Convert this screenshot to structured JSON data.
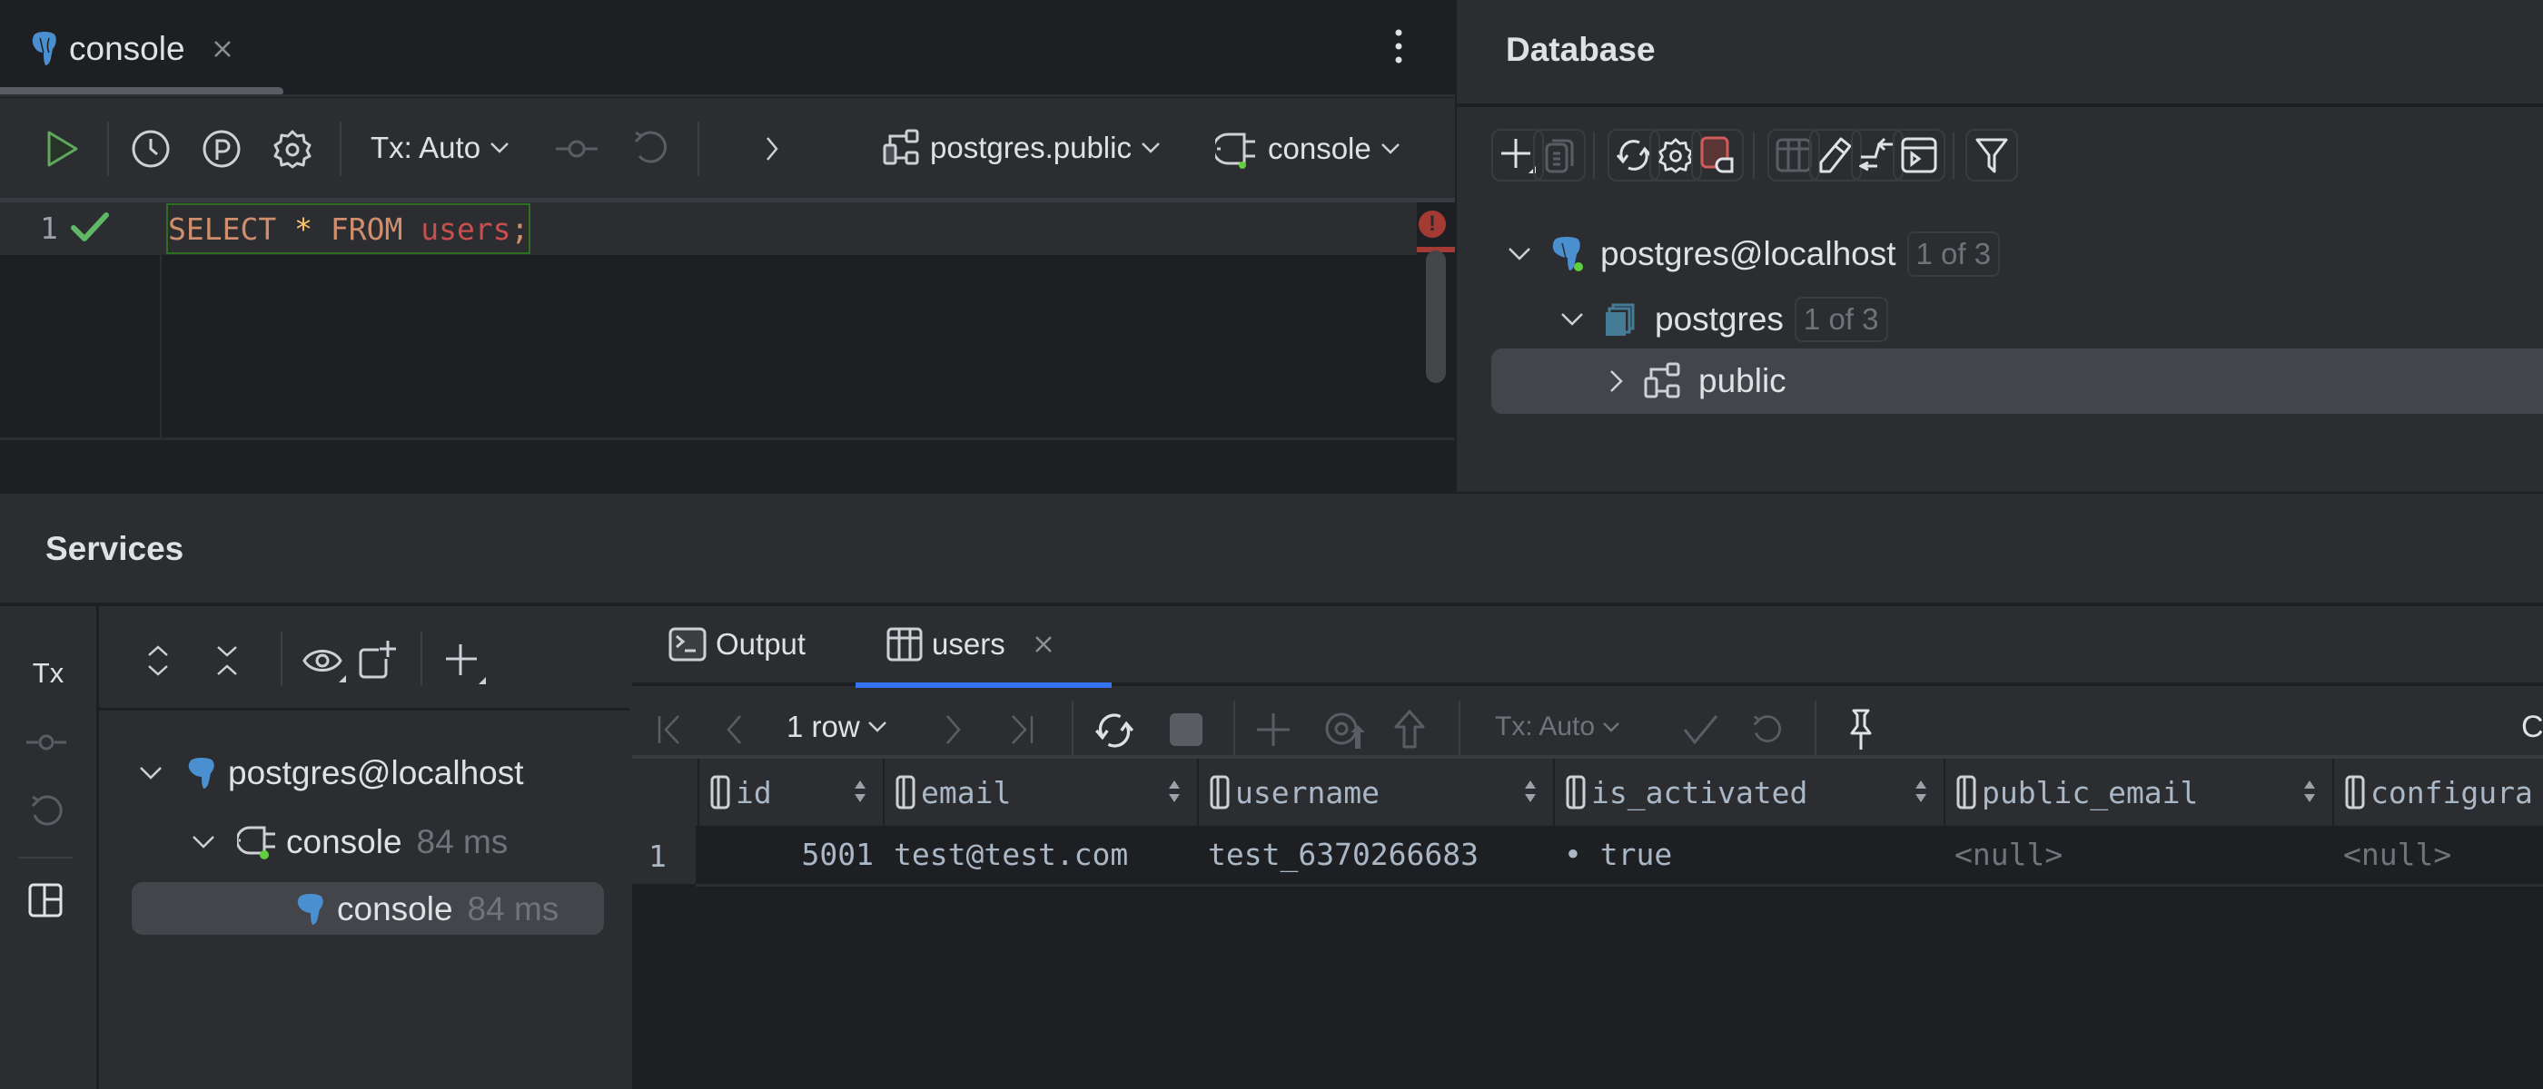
{
  "editor": {
    "tab": {
      "icon": "postgresql-elephant-icon",
      "label": "console",
      "close": "close-icon"
    },
    "more_menu": "more-vertical-icon",
    "toolbar": {
      "run": "run-icon",
      "history": "history-icon",
      "explain": "explain-plan-icon",
      "settings": "gear-icon",
      "tx_mode": "Tx: Auto",
      "commit": "commit-icon",
      "rollback": "rollback-icon",
      "more": "chevron-right-icon",
      "schema": "postgres.public",
      "session": "console"
    },
    "lines": [
      {
        "number": "1",
        "status": "ok",
        "tokens": [
          {
            "text": "SELECT",
            "kind": "kw"
          },
          {
            "text": " ",
            "kind": "ws"
          },
          {
            "text": "*",
            "kind": "star"
          },
          {
            "text": " ",
            "kind": "ws"
          },
          {
            "text": "FROM",
            "kind": "kw"
          },
          {
            "text": " ",
            "kind": "ws"
          },
          {
            "text": "users",
            "kind": "tbl"
          },
          {
            "text": ";",
            "kind": "semi"
          }
        ]
      }
    ],
    "error_indicator": "!"
  },
  "database": {
    "title": "Database",
    "toolbar": [
      "add-icon",
      "duplicate-icon",
      "refresh-icon",
      "gear-icon",
      "disconnect-icon",
      "table-icon",
      "edit-icon",
      "jump-icon",
      "console-icon",
      "filter-icon"
    ],
    "tree": [
      {
        "label": "postgres@localhost",
        "badge": "1 of 3",
        "expanded": true,
        "level": 0
      },
      {
        "label": "postgres",
        "badge": "1 of 3",
        "expanded": true,
        "level": 1
      },
      {
        "label": "public",
        "expanded": false,
        "level": 2,
        "selected": true
      }
    ]
  },
  "services": {
    "title": "Services",
    "strip": {
      "tx": "Tx"
    },
    "tree": [
      {
        "label": "postgres@localhost",
        "level": 0
      },
      {
        "label": "console",
        "time": "84 ms",
        "level": 1
      },
      {
        "label": "console",
        "time": "84 ms",
        "level": 2,
        "selected": true
      }
    ],
    "result": {
      "tabs": [
        {
          "label": "Output"
        },
        {
          "label": "users",
          "active": true
        }
      ],
      "rows_label": "1 row",
      "tx_mode": "Tx: Auto",
      "right_label": "C",
      "columns": [
        "id",
        "email",
        "username",
        "is_activated",
        "public_email",
        "configura"
      ],
      "rows": [
        {
          "num": "1",
          "cells": [
            "5001",
            "test@test.com",
            "test_6370266683",
            "• true",
            "<null>",
            "<null>"
          ]
        }
      ]
    }
  },
  "colors": {
    "accent": "#3574f0",
    "keyword": "#cf8e6d",
    "table": "#c94f4f",
    "ok": "#5fb865",
    "error": "#a33a33",
    "connected": "#5fd03d"
  }
}
